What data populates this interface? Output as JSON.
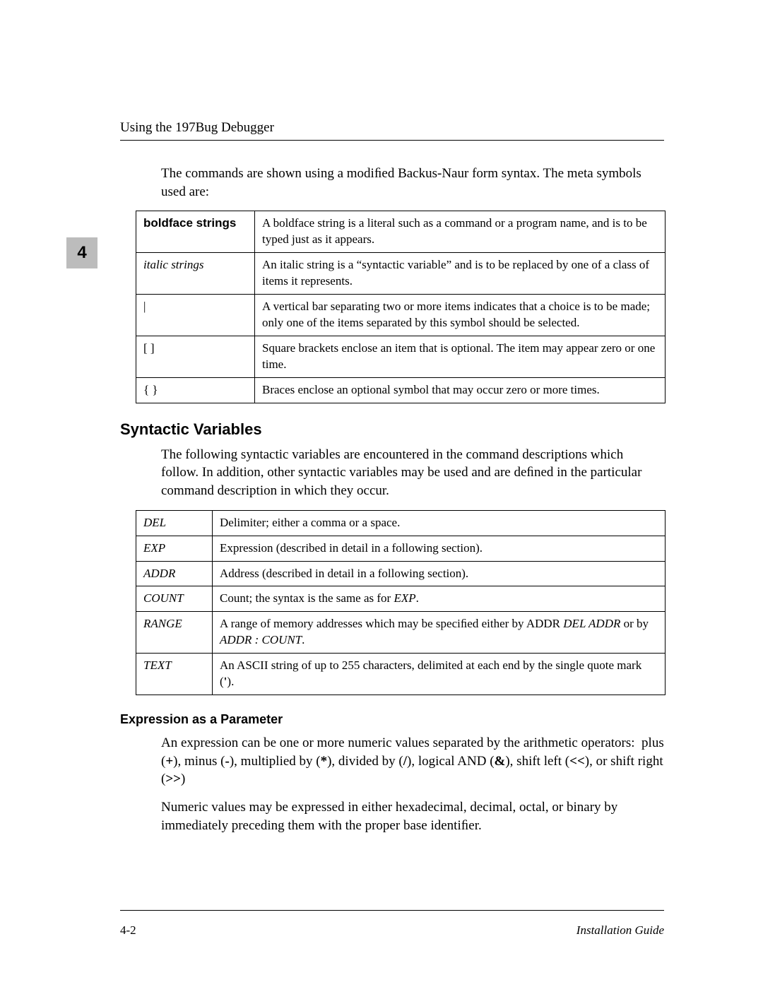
{
  "header": {
    "running_head": "Using the 197Bug Debugger"
  },
  "chapter_tab": "4",
  "intro_para": "The commands are shown using a modiﬁed Backus-Naur form syntax. The meta symbols used are:",
  "meta_table": [
    {
      "key": "boldface strings",
      "key_style": "sans-bold",
      "desc": "A boldface string is a literal such as a command or a program name, and is to be typed just as it appears."
    },
    {
      "key": "italic strings",
      "key_style": "ital",
      "desc": "An italic string is a “syntactic variable” and is to be replaced by one of a class of items it represents."
    },
    {
      "key": "|",
      "key_style": "",
      "desc": "A vertical bar separating two or more items indicates that a choice is to be made; only one of the items separated by this symbol should be selected."
    },
    {
      "key": "[ ]",
      "key_style": "",
      "desc": "Square brackets enclose an item that is optional. The item may appear zero or one time."
    },
    {
      "key": "{ }",
      "key_style": "",
      "desc": "Braces enclose an optional symbol that may occur zero or more times."
    }
  ],
  "section_heading": "Syntactic Variables",
  "section_para": "The following syntactic variables are encountered in the command descriptions which follow. In addition, other syntactic variables may be used and are deﬁned in the particular command description in which they occur.",
  "var_table": [
    {
      "key": "DEL",
      "desc_html": "Delimiter; either a comma or a space."
    },
    {
      "key": "EXP",
      "desc_html": "Expression (described in detail in a following section)."
    },
    {
      "key": "ADDR",
      "desc_html": "Address (described in detail in a following section)."
    },
    {
      "key": "COUNT",
      "desc_html": "Count; the syntax is the same as for <i>EXP</i>."
    },
    {
      "key": "RANGE",
      "desc_html": "A range of memory addresses which may be speciﬁed either by ADDR <i>DEL ADDR</i> or by <i>ADDR : COUNT</i>."
    },
    {
      "key": "TEXT",
      "desc_html": "An ASCII string of up to 255 characters, delimited at each end by the single quote mark (<b>'</b>)."
    }
  ],
  "subsection_heading": "Expression as a Parameter",
  "expr_para_html": "An expression can be one or more numeric values separated by the arithmetic operators:  plus (<b>+</b>), minus (<b>-</b>), multiplied by (<b>*</b>), divided by (<b>/</b>), logical AND (<b>&amp;</b>), shift left (<b>&lt;&lt;</b>), or shift right (<b>&gt;&gt;</b>)",
  "numeric_para": "Numeric values may be expressed in either hexadecimal, decimal, octal, or binary by immediately preceding them with the proper base identiﬁer.",
  "footer": {
    "page_num": "4-2",
    "doc_title": "Installation Guide"
  }
}
